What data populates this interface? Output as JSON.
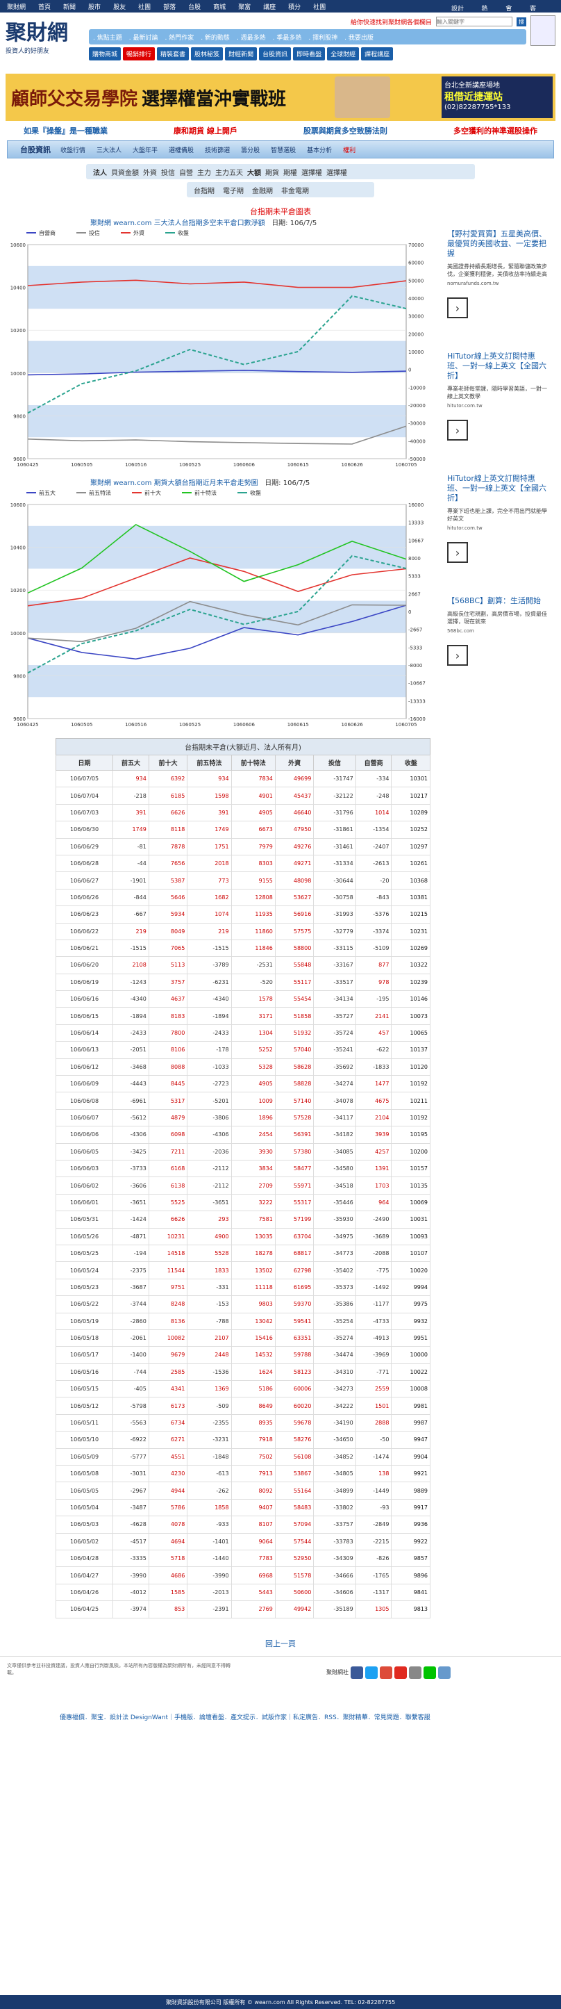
{
  "topnav": [
    "聚財網",
    "首頁",
    "新聞",
    "股市",
    "股友",
    "社團",
    "部落",
    "台股",
    "商城",
    "聚富",
    "講座",
    "積分",
    "社團"
  ],
  "topnav_right": [
    "設計法",
    "熱門",
    "會員",
    "客服"
  ],
  "logo": {
    "main": "聚財網",
    "tag": "投資人的好朋友"
  },
  "header": {
    "promo": "給你快速找到聚財網各個欄目",
    "search_placeholder": "輸入關鍵字",
    "search_btn": "搜"
  },
  "navstrip": [
    "焦點主題",
    "最新討論",
    "熱門作家",
    "新的動態",
    "週最多熱",
    "季最多熱",
    "擇利股神",
    "我要出版"
  ],
  "navrow2": [
    {
      "label": "購物商城",
      "hl": false
    },
    {
      "label": "暢銷排行",
      "hl": true
    },
    {
      "label": "精裝套書",
      "hl": false
    },
    {
      "label": "股林秘笈",
      "hl": false
    },
    {
      "label": "財經新聞",
      "hl": false
    },
    {
      "label": "台股資訊",
      "hl": false
    },
    {
      "label": "即時看盤",
      "hl": false
    },
    {
      "label": "全球財經",
      "hl": false
    },
    {
      "label": "課程講座",
      "hl": false
    }
  ],
  "banner": {
    "title1": "顧師父交易學院",
    "title2": "選擇權當沖實戰班",
    "side_a": "台北全新講座場地",
    "side_b": "租借近捷運站",
    "side_c": "(02)82287755*133"
  },
  "slogans": [
    "如果『操盤』是一種職業",
    "康和期貨 線上開戶",
    "股票與期貨多空致勝法則",
    "多空獲利的神準選股操作"
  ],
  "menubar": {
    "home": "台股資訊",
    "items": [
      "收盤行情",
      "三大法人",
      "大盤年平",
      "選權備股",
      "技術篩選",
      "籌分股",
      "智慧選股",
      "基本分析"
    ],
    "hot": "權利"
  },
  "subnav": [
    "法人",
    "貝資金額",
    "外資",
    "投信",
    "自營",
    "主力",
    "主力五天",
    "大額",
    "期貨",
    "期權",
    "選擇權",
    "選擇權"
  ],
  "subnav2": [
    "台指期",
    "電子期",
    "金融期",
    "非金電期"
  ],
  "section_title": "台指期未平倉圖表",
  "chart1": {
    "title_pre": "聚財網 wearn.com 三大法人台指期多空未平倉口數淨額",
    "date_label": "日期: 106/7/5",
    "legend": [
      {
        "name": "自營商",
        "color": "#3b46c4"
      },
      {
        "name": "投信",
        "color": "#8c8c8c"
      },
      {
        "name": "外資",
        "color": "#e3342f"
      },
      {
        "name": "收盤",
        "color": "#2aa38f"
      }
    ]
  },
  "chart2": {
    "title_pre": "聚財網 wearn.com 期貨大額台指期近月未平倉走勢圖",
    "date_label": "日期: 106/7/5",
    "legend": [
      {
        "name": "前五大",
        "color": "#3b46c4"
      },
      {
        "name": "前五特法",
        "color": "#8c8c8c"
      },
      {
        "name": "前十大",
        "color": "#e3342f"
      },
      {
        "name": "前十特法",
        "color": "#22c422"
      },
      {
        "name": "收盤",
        "color": "#2aa38f"
      }
    ]
  },
  "chart_data": [
    {
      "type": "line",
      "title": "三大法人台指期多空未平倉口數淨額",
      "x": [
        "1060425",
        "1060505",
        "1060516",
        "1060525",
        "1060606",
        "1060615",
        "1060626",
        "1060705"
      ],
      "ylim_left": [
        9600,
        10600
      ],
      "ylim_right": [
        -50000,
        70000
      ],
      "series": [
        {
          "name": "自營商",
          "values": [
            -3000,
            -2500,
            -1500,
            -1000,
            -500,
            -1200,
            -1600,
            -934
          ]
        },
        {
          "name": "投信",
          "values": [
            -39000,
            -40000,
            -39500,
            -40500,
            -41000,
            -41500,
            -41800,
            -31747
          ]
        },
        {
          "name": "外資",
          "values": [
            47000,
            49000,
            50000,
            48000,
            49000,
            46000,
            46000,
            49699
          ]
        },
        {
          "name": "收盤",
          "values": [
            9813,
            9950,
            10010,
            10110,
            10040,
            10100,
            10360,
            10301
          ]
        }
      ]
    },
    {
      "type": "line",
      "title": "期貨大額台指期近月未平倉走勢圖",
      "x": [
        "1060425",
        "1060505",
        "1060516",
        "1060525",
        "1060606",
        "1060615",
        "1060626",
        "1060705"
      ],
      "ylim_left": [
        9600,
        10600
      ],
      "ylim_right": [
        -16000,
        16000
      ],
      "series": [
        {
          "name": "前五大",
          "values": [
            -3974,
            -6123,
            -7095,
            -5500,
            -2400,
            -3500,
            -1500,
            934
          ]
        },
        {
          "name": "前五特法",
          "values": [
            -3974,
            -4500,
            -2500,
            1500,
            -500,
            -2000,
            1000,
            934
          ]
        },
        {
          "name": "前十大",
          "values": [
            853,
            2000,
            5000,
            8000,
            6000,
            3000,
            5500,
            6392
          ]
        },
        {
          "name": "前十特法",
          "values": [
            2769,
            6500,
            13000,
            9000,
            4500,
            7000,
            10500,
            7834
          ]
        },
        {
          "name": "收盤",
          "values": [
            9813,
            9950,
            10010,
            10110,
            10040,
            10100,
            10360,
            10301
          ]
        }
      ]
    }
  ],
  "table": {
    "caption": "台指期未平倉(大額近月、法人所有月)",
    "headers": [
      "日期",
      "前五大",
      "前十大",
      "前五特法",
      "前十特法",
      "外資",
      "投信",
      "自營商",
      "收盤"
    ],
    "rows": [
      [
        "106/07/05",
        "934",
        "6392",
        "934",
        "7834",
        "49699",
        "-31747",
        "-334",
        "10301"
      ],
      [
        "106/07/04",
        "-218",
        "6185",
        "1598",
        "4901",
        "45437",
        "-32122",
        "-248",
        "10217"
      ],
      [
        "106/07/03",
        "391",
        "6626",
        "391",
        "4905",
        "46640",
        "-31796",
        "1014",
        "10289"
      ],
      [
        "106/06/30",
        "1749",
        "8118",
        "1749",
        "6673",
        "47950",
        "-31861",
        "-1354",
        "10252"
      ],
      [
        "106/06/29",
        "-81",
        "7878",
        "1751",
        "7979",
        "49276",
        "-31461",
        "-2407",
        "10297"
      ],
      [
        "106/06/28",
        "-44",
        "7656",
        "2018",
        "8303",
        "49271",
        "-31334",
        "-2613",
        "10261"
      ],
      [
        "106/06/27",
        "-1901",
        "5387",
        "773",
        "9155",
        "48098",
        "-30644",
        "-20",
        "10368"
      ],
      [
        "106/06/26",
        "-844",
        "5646",
        "1682",
        "12808",
        "53627",
        "-30758",
        "-843",
        "10381"
      ],
      [
        "106/06/23",
        "-667",
        "5934",
        "1074",
        "11935",
        "56916",
        "-31993",
        "-5376",
        "10215"
      ],
      [
        "106/06/22",
        "219",
        "8049",
        "219",
        "11860",
        "57575",
        "-32779",
        "-3374",
        "10231"
      ],
      [
        "106/06/21",
        "-1515",
        "7065",
        "-1515",
        "11846",
        "58800",
        "-33115",
        "-5109",
        "10269"
      ],
      [
        "106/06/20",
        "2108",
        "5113",
        "-3789",
        "-2531",
        "55848",
        "-33167",
        "877",
        "10322"
      ],
      [
        "106/06/19",
        "-1243",
        "3757",
        "-6231",
        "-520",
        "55117",
        "-33517",
        "978",
        "10239"
      ],
      [
        "106/06/16",
        "-4340",
        "4637",
        "-4340",
        "1578",
        "55454",
        "-34134",
        "-195",
        "10146"
      ],
      [
        "106/06/15",
        "-1894",
        "8183",
        "-1894",
        "3171",
        "51858",
        "-35727",
        "2141",
        "10073"
      ],
      [
        "106/06/14",
        "-2433",
        "7800",
        "-2433",
        "1304",
        "51932",
        "-35724",
        "457",
        "10065"
      ],
      [
        "106/06/13",
        "-2051",
        "8106",
        "-178",
        "5252",
        "57040",
        "-35241",
        "-622",
        "10137"
      ],
      [
        "106/06/12",
        "-3468",
        "8088",
        "-1033",
        "5328",
        "58628",
        "-35692",
        "-1833",
        "10120"
      ],
      [
        "106/06/09",
        "-4443",
        "8445",
        "-2723",
        "4905",
        "58828",
        "-34274",
        "1477",
        "10192"
      ],
      [
        "106/06/08",
        "-6961",
        "5317",
        "-5201",
        "1009",
        "57140",
        "-34078",
        "4675",
        "10211"
      ],
      [
        "106/06/07",
        "-5612",
        "4879",
        "-3806",
        "1896",
        "57528",
        "-34117",
        "2104",
        "10192"
      ],
      [
        "106/06/06",
        "-4306",
        "6098",
        "-4306",
        "2454",
        "56391",
        "-34182",
        "3939",
        "10195"
      ],
      [
        "106/06/05",
        "-3425",
        "7211",
        "-2036",
        "3930",
        "57380",
        "-34085",
        "4257",
        "10200"
      ],
      [
        "106/06/03",
        "-3733",
        "6168",
        "-2112",
        "3834",
        "58477",
        "-34580",
        "1391",
        "10157"
      ],
      [
        "106/06/02",
        "-3606",
        "6138",
        "-2112",
        "2709",
        "55971",
        "-34518",
        "1703",
        "10135"
      ],
      [
        "106/06/01",
        "-3651",
        "5525",
        "-3651",
        "3222",
        "55317",
        "-35446",
        "964",
        "10069"
      ],
      [
        "106/05/31",
        "-1424",
        "6626",
        "293",
        "7581",
        "57199",
        "-35930",
        "-2490",
        "10031"
      ],
      [
        "106/05/26",
        "-4871",
        "10231",
        "4900",
        "13035",
        "63704",
        "-34975",
        "-3689",
        "10093"
      ],
      [
        "106/05/25",
        "-194",
        "14518",
        "5528",
        "18278",
        "68817",
        "-34773",
        "-2088",
        "10107"
      ],
      [
        "106/05/24",
        "-2375",
        "11544",
        "1833",
        "13502",
        "62798",
        "-35402",
        "-775",
        "10020"
      ],
      [
        "106/05/23",
        "-3687",
        "9751",
        "-331",
        "11118",
        "61695",
        "-35373",
        "-1492",
        "9994"
      ],
      [
        "106/05/22",
        "-3744",
        "8248",
        "-153",
        "9803",
        "59370",
        "-35386",
        "-1177",
        "9975"
      ],
      [
        "106/05/19",
        "-2860",
        "8136",
        "-788",
        "13042",
        "59541",
        "-35254",
        "-4733",
        "9932"
      ],
      [
        "106/05/18",
        "-2061",
        "10082",
        "2107",
        "15416",
        "63351",
        "-35274",
        "-4913",
        "9951"
      ],
      [
        "106/05/17",
        "-1400",
        "9679",
        "2448",
        "14532",
        "59788",
        "-34474",
        "-3969",
        "10000"
      ],
      [
        "106/05/16",
        "-744",
        "2585",
        "-1536",
        "1624",
        "58123",
        "-34310",
        "-771",
        "10022"
      ],
      [
        "106/05/15",
        "-405",
        "4341",
        "1369",
        "5186",
        "60006",
        "-34273",
        "2559",
        "10008"
      ],
      [
        "106/05/12",
        "-5798",
        "6173",
        "-509",
        "8649",
        "60020",
        "-34222",
        "1501",
        "9981"
      ],
      [
        "106/05/11",
        "-5563",
        "6734",
        "-2355",
        "8935",
        "59678",
        "-34190",
        "2888",
        "9987"
      ],
      [
        "106/05/10",
        "-6922",
        "6271",
        "-3231",
        "7918",
        "58276",
        "-34650",
        "-50",
        "9947"
      ],
      [
        "106/05/09",
        "-5777",
        "4551",
        "-1848",
        "7502",
        "56108",
        "-34852",
        "-1474",
        "9904"
      ],
      [
        "106/05/08",
        "-3031",
        "4230",
        "-613",
        "7913",
        "53867",
        "-34805",
        "138",
        "9921"
      ],
      [
        "106/05/05",
        "-2967",
        "4944",
        "-262",
        "8092",
        "55164",
        "-34899",
        "-1449",
        "9889"
      ],
      [
        "106/05/04",
        "-3487",
        "5786",
        "1858",
        "9407",
        "58483",
        "-33802",
        "-93",
        "9917"
      ],
      [
        "106/05/03",
        "-4628",
        "4078",
        "-933",
        "8107",
        "57094",
        "-33757",
        "-2849",
        "9936"
      ],
      [
        "106/05/02",
        "-4517",
        "4694",
        "-1401",
        "9064",
        "57544",
        "-33783",
        "-2215",
        "9922"
      ],
      [
        "106/04/28",
        "-3335",
        "5718",
        "-1440",
        "7783",
        "52950",
        "-34309",
        "-826",
        "9857"
      ],
      [
        "106/04/27",
        "-3990",
        "4686",
        "-3990",
        "6968",
        "51578",
        "-34666",
        "-1765",
        "9896"
      ],
      [
        "106/04/26",
        "-4012",
        "1585",
        "-2013",
        "5443",
        "50600",
        "-34606",
        "-1317",
        "9841"
      ],
      [
        "106/04/25",
        "-3974",
        "853",
        "-2391",
        "2769",
        "49942",
        "-35189",
        "1305",
        "9813"
      ]
    ]
  },
  "ads": [
    {
      "head": "【野村愛買賣】五星美高價、最優質的美國收益、一定要把握",
      "desc": "美國證券持續長期增長，緊隨聯儲政策步伐，企業獲利穩健，美債收益率持續走高",
      "url": "nomurafunds.com.tw"
    },
    {
      "head": "HiTutor線上英文訂閱特惠班、一對一線上英文【全國六折】",
      "desc": "專業老師每堂課，隨時學習美語，一對一線上英文教學",
      "url": "hitutor.com.tw"
    },
    {
      "head": "HiTutor線上英文訂閱特惠班、一對一線上英文【全國六折】",
      "desc": "專業下班也能上課，完全不用出門就能學好英文",
      "url": "hitutor.com.tw"
    },
    {
      "head": "【568BC】劃算：生活開始",
      "desc": "高級長住宅規劃，高房價市場，投資最佳選擇，現在就來",
      "url": "568bc.com"
    }
  ],
  "backtop": "回上一頁",
  "footer": {
    "disclaimer": "文章僅供參考並非投資建議，投資人應自行判斷風險。本站所有內容版權為聚財網所有，未經同意不得轉載。",
    "follow": "聚財網社",
    "links": "優惠福價．聚宝．設計法 DesignWant｜手機版．論壇看盤．產文提示．試版作家｜私定廣告．RSS．聚財精華．常見問題．聯繫客服",
    "copyright": "聚財資訊股份有限公司 版權所有 © wearn.com All Rights Reserved. TEL: 02-82287755"
  },
  "colors": {
    "navy": "#1a3a6e",
    "blue": "#1a5ea8",
    "red": "#d00",
    "band": "#a9c8ea"
  }
}
